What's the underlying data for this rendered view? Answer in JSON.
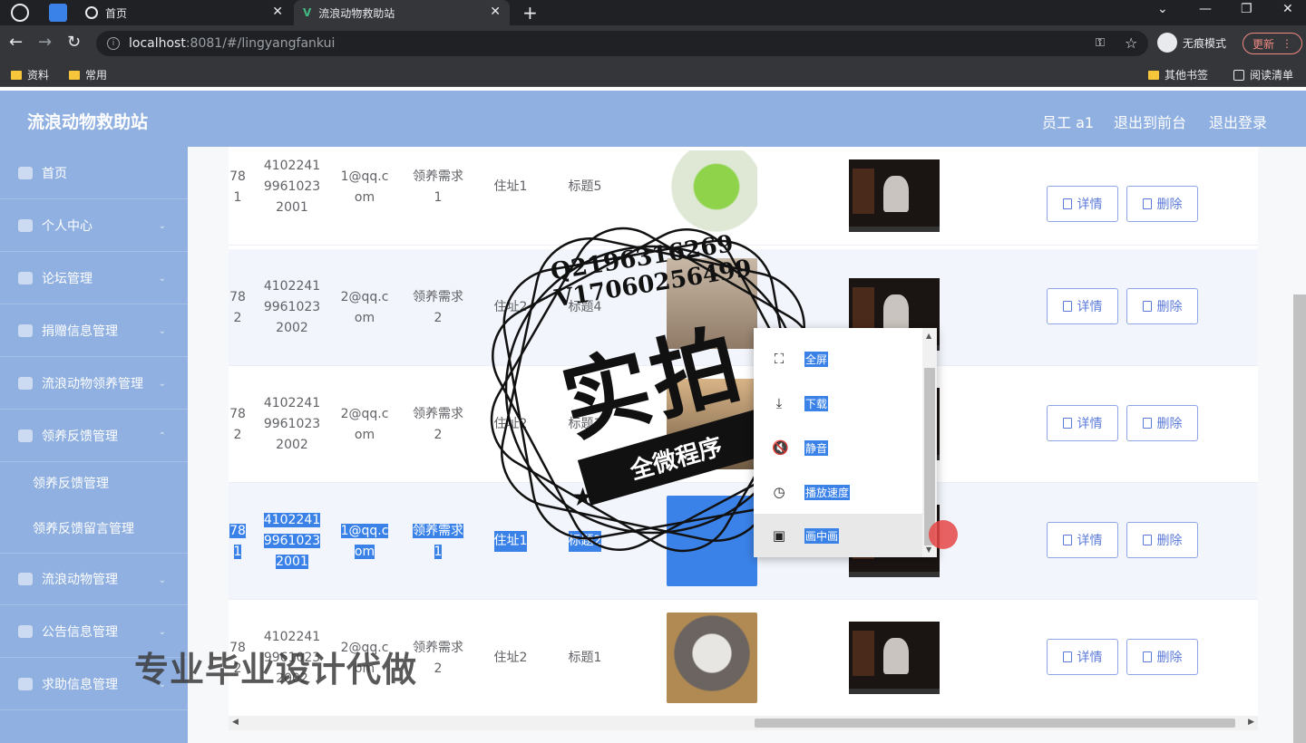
{
  "browser": {
    "tabs": [
      {
        "label": "首页",
        "active": false
      },
      {
        "label": "流浪动物救助站",
        "active": true
      }
    ],
    "url_host": "localhost",
    "url_path": ":8081/#/lingyangfankui",
    "incognito_label": "无痕模式",
    "update_label": "更新",
    "bookmarks": [
      "资料",
      "常用"
    ],
    "bookmarks_right": [
      "其他书签",
      "阅读清单"
    ]
  },
  "header": {
    "title": "流浪动物救助站",
    "user": "员工 a1",
    "to_front": "退出到前台",
    "logout": "退出登录"
  },
  "sidebar": {
    "items": [
      {
        "label": "首页"
      },
      {
        "label": "个人中心"
      },
      {
        "label": "论坛管理"
      },
      {
        "label": "捐赠信息管理"
      },
      {
        "label": "流浪动物领养管理"
      },
      {
        "label": "领养反馈管理"
      },
      {
        "label": "流浪动物管理"
      },
      {
        "label": "公告信息管理"
      },
      {
        "label": "求助信息管理"
      }
    ],
    "sub_items": [
      {
        "label": "领养反馈管理"
      },
      {
        "label": "领养反馈留言管理"
      }
    ]
  },
  "table": {
    "rows": [
      {
        "c0a": "78",
        "c0b": "1",
        "id1": "4102241",
        "id2": "9961023",
        "id3": "2001",
        "em1": "1@qq.c",
        "em2": "om",
        "req1": "领养需求",
        "req2": "1",
        "addr": "住址1",
        "title": "标题5",
        "selected": false
      },
      {
        "c0a": "78",
        "c0b": "2",
        "id1": "4102241",
        "id2": "9961023",
        "id3": "2002",
        "em1": "2@qq.c",
        "em2": "om",
        "req1": "领养需求",
        "req2": "2",
        "addr": "住址2",
        "title": "标题4",
        "selected": false
      },
      {
        "c0a": "78",
        "c0b": "2",
        "id1": "4102241",
        "id2": "9961023",
        "id3": "2002",
        "em1": "2@qq.c",
        "em2": "om",
        "req1": "领养需求",
        "req2": "2",
        "addr": "住址2",
        "title": "标题3",
        "selected": false
      },
      {
        "c0a": "78",
        "c0b": "1",
        "id1": "4102241",
        "id2": "9961023",
        "id3": "2001",
        "em1": "1@qq.c",
        "em2": "om",
        "req1": "领养需求",
        "req2": "1",
        "addr": "住址1",
        "title": "标题2",
        "selected": true
      },
      {
        "c0a": "78",
        "c0b": "2",
        "id1": "4102241",
        "id2": "9961023",
        "id3": "2002",
        "em1": "2@qq.c",
        "em2": "om",
        "req1": "领养需求",
        "req2": "2",
        "addr": "住址2",
        "title": "标题1",
        "selected": false
      }
    ],
    "detail_label": "详情",
    "delete_label": "删除"
  },
  "context_menu": {
    "items": [
      {
        "label": "全屏",
        "icon": "fullscreen-icon"
      },
      {
        "label": "下载",
        "icon": "download-icon"
      },
      {
        "label": "静音",
        "icon": "mute-icon"
      },
      {
        "label": "播放速度",
        "icon": "speed-icon"
      },
      {
        "label": "画中画",
        "icon": "pip-icon"
      }
    ]
  },
  "watermark": {
    "qq": "Q2196316269",
    "wechat": "V17060256499",
    "big": "实拍",
    "banner": "全微程序",
    "bottom": "专业毕业设计代做"
  },
  "colors": {
    "header_bg": "#8fb0e0",
    "button_border": "#8fa6e6",
    "selection": "#3b82e8"
  }
}
